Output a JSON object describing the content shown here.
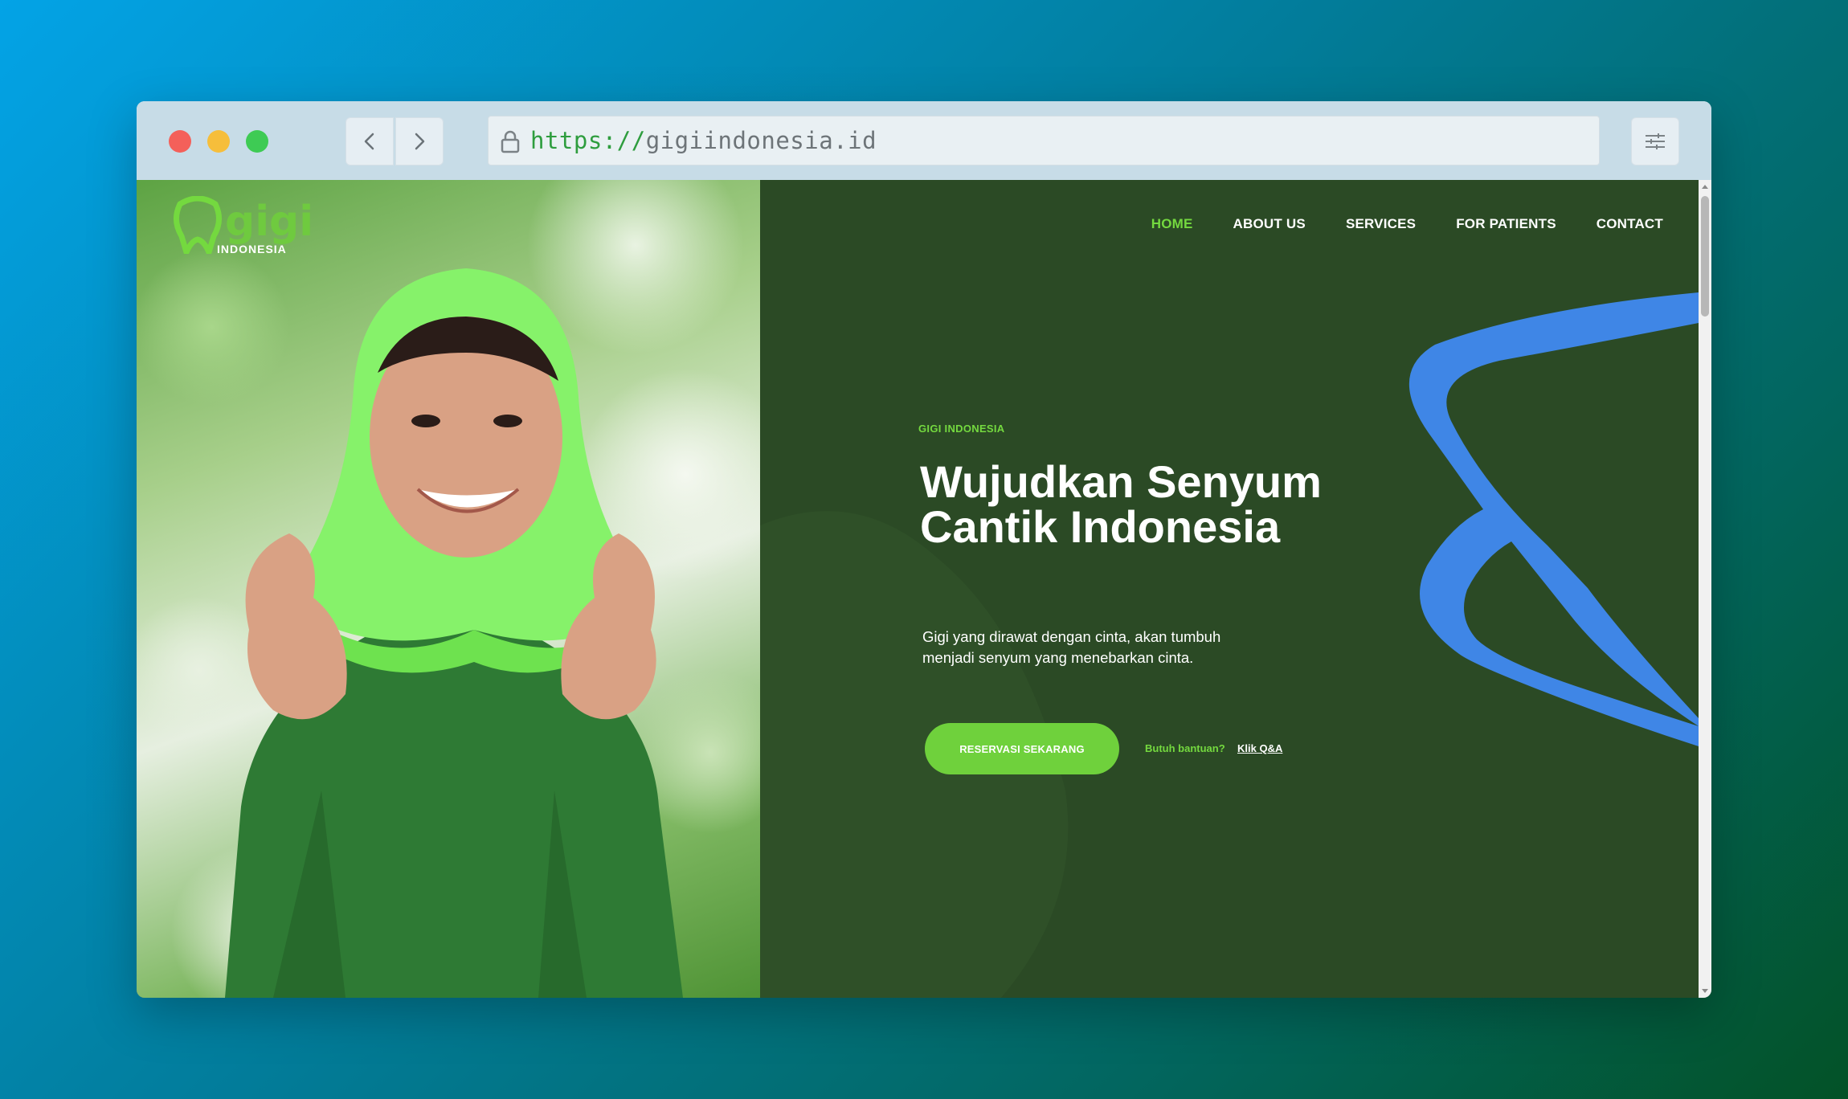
{
  "browser": {
    "url_protocol": "https://",
    "url_host": "gigiindonesia.id",
    "icons": {
      "back": "chevron-left-icon",
      "forward": "chevron-right-icon",
      "lock": "lock-icon",
      "menu": "sliders-icon"
    }
  },
  "site": {
    "logo_text": "gigi",
    "logo_subtext": "INDONESIA",
    "nav": [
      {
        "label": "HOME",
        "active": true
      },
      {
        "label": "ABOUT US"
      },
      {
        "label": "SERVICES"
      },
      {
        "label": "FOR PATIENTS"
      },
      {
        "label": "CONTACT"
      }
    ],
    "hero": {
      "eyebrow": "GIGI INDONESIA",
      "headline": "Wujudkan Senyum Cantik Indonesia",
      "subtext": "Gigi yang dirawat dengan cinta, akan tumbuh menjadi senyum yang menebarkan cinta.",
      "cta_label": "RESERVASI SEKARANG",
      "help_text": "Butuh bantuan?",
      "help_link": "Klik Q&A"
    },
    "colors": {
      "hero_bg": "#2b4a25",
      "accent_green": "#74d93f",
      "button_green": "#6fd13c",
      "tooth_outline_blue": "#3f86e6"
    }
  }
}
